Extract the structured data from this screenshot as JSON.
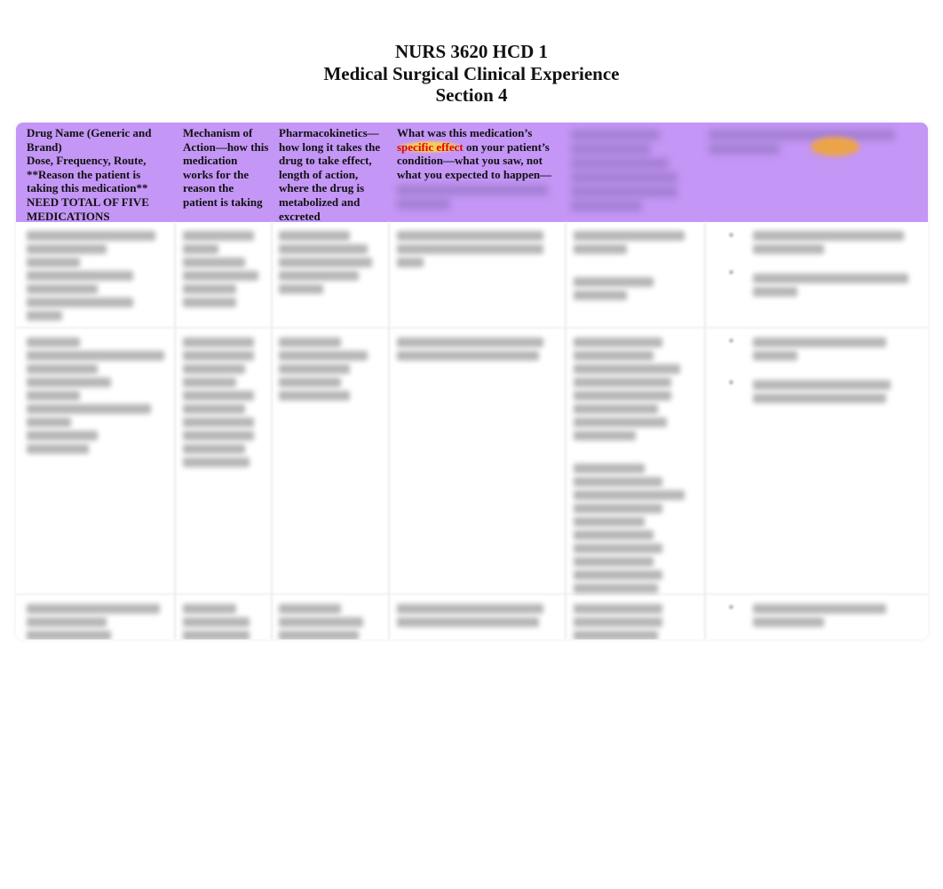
{
  "document": {
    "title_lines": [
      "NURS 3620 HCD 1",
      "Medical Surgical Clinical Experience",
      "Section 4"
    ]
  },
  "table": {
    "header_color": "#c496f6",
    "columns": [
      {
        "lines_part1": "Drug Name (Generic and Brand)",
        "lines_part2": "Dose, Frequency, Route, **Reason the patient is taking this medication** NEED TOTAL OF FIVE MEDICATIONS"
      },
      {
        "text": "Mechanism of Action—how this medication works for the reason the patient is taking"
      },
      {
        "text": "Pharmacokinetics—how long it takes the drug to take effect, length of action, where the drug is metabolized and excreted"
      },
      {
        "text_before": "What was this medication’s ",
        "highlight": "specific effect",
        "highlight_color": "#e60000",
        "text_after": " on your patient’s condition—what you saw, not what you expected to happen—"
      },
      {
        "text": "[blurred]"
      },
      {
        "text": "[blurred]"
      }
    ],
    "rows": [
      {
        "blurred": true
      },
      {
        "blurred": true
      },
      {
        "blurred": true
      }
    ]
  }
}
